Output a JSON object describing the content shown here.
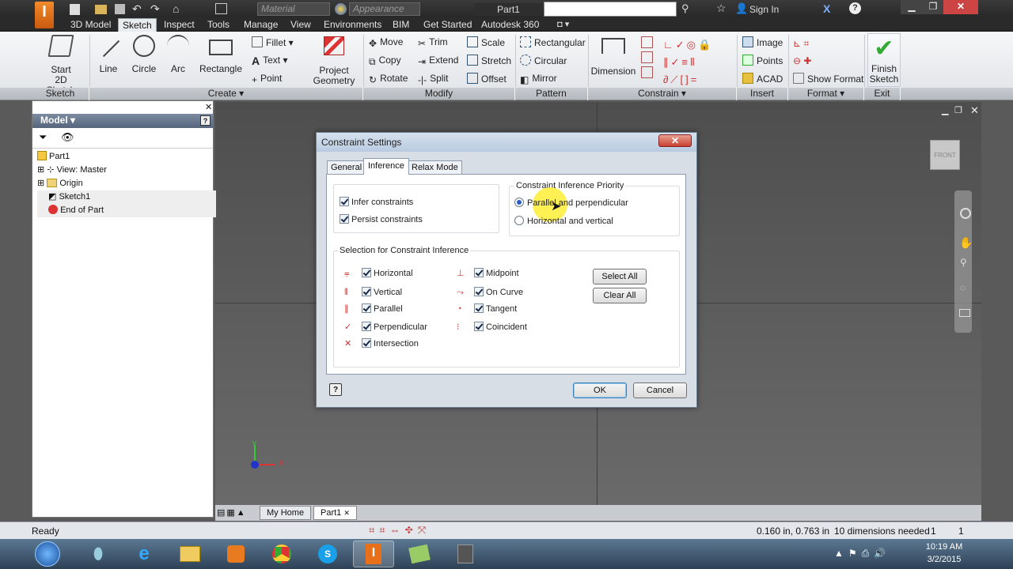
{
  "qat": {
    "material": "Material",
    "appearance": "Appearance",
    "doc_title": "Part1",
    "signin": "Sign In"
  },
  "tabs": [
    "3D Model",
    "Sketch",
    "Inspect",
    "Tools",
    "Manage",
    "View",
    "Environments",
    "BIM",
    "Get Started",
    "Autodesk 360"
  ],
  "ribbon": {
    "start_sketch": [
      "Start",
      "2D Sketch"
    ],
    "line": "Line",
    "circle": "Circle",
    "arc": "Arc",
    "rectangle": "Rectangle",
    "fillet": "Fillet",
    "text": "Text",
    "point": "Point",
    "project_geometry": [
      "Project",
      "Geometry"
    ],
    "move": "Move",
    "copy": "Copy",
    "rotate": "Rotate",
    "trim": "Trim",
    "extend": "Extend",
    "split": "Split",
    "scale": "Scale",
    "stretch": "Stretch",
    "offset": "Offset",
    "rect_pattern": "Rectangular",
    "circ_pattern": "Circular",
    "mirror": "Mirror",
    "dimension": "Dimension",
    "image": "Image",
    "points": "Points",
    "acad": "ACAD",
    "show_format": "Show Format",
    "finish_sketch": [
      "Finish",
      "Sketch"
    ]
  },
  "panels": [
    "Sketch",
    "Create",
    "Modify",
    "Pattern",
    "Constrain",
    "Insert",
    "Format",
    "Exit"
  ],
  "browser": {
    "title": "Model",
    "items": [
      "Part1",
      "View: Master",
      "Origin",
      "Sketch1",
      "End of Part"
    ]
  },
  "dialog": {
    "title": "Constraint Settings",
    "tabs": [
      "General",
      "Inference",
      "Relax Mode"
    ],
    "infer_label": "Infer constraints",
    "persist_label": "Persist constraints",
    "priority_title": "Constraint Inference Priority",
    "priority_opt1": "Parallel and perpendicular",
    "priority_opt2": "Horizontal and vertical",
    "selection_title": "Selection for Constraint Inference",
    "col1": [
      "Horizontal",
      "Vertical",
      "Parallel",
      "Perpendicular",
      "Intersection"
    ],
    "col2": [
      "Midpoint",
      "On Curve",
      "Tangent",
      "Coincident"
    ],
    "select_all": "Select All",
    "clear_all": "Clear All",
    "ok": "OK",
    "cancel": "Cancel"
  },
  "viewcube": {
    "face": "FRONT"
  },
  "view_tabs": [
    "My Home",
    "Part1"
  ],
  "status": {
    "left": "Ready",
    "coords": "0.160 in, 0.763 in",
    "dims": "10 dimensions needed",
    "n1": "1",
    "n2": "1"
  },
  "clock": {
    "time": "10:19 AM",
    "date": "3/2/2015"
  },
  "colors": {
    "accent": "#2a5ad0",
    "ribbon_bg": "#e9ecef",
    "dialog_bg": "#d8dee6",
    "canvas": "#5a5a5a"
  }
}
